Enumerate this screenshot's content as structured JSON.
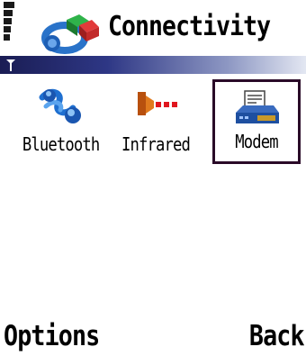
{
  "title_pane": {
    "title": "Connectivity",
    "app_icon": "connectivity-icon",
    "signal_icon": "signal-strength-icon",
    "antenna_icon": "antenna-icon"
  },
  "grid": {
    "items": [
      {
        "label": "Bluetooth",
        "icon": "bluetooth-icon",
        "selected": false
      },
      {
        "label": "Infrared",
        "icon": "infrared-icon",
        "selected": false
      },
      {
        "label": "Modem",
        "icon": "modem-icon",
        "selected": true
      }
    ]
  },
  "softkeys": {
    "left": "Options",
    "right": "Back"
  },
  "colors": {
    "band_dark": "#1a1d54",
    "band_light": "#e3e7f2",
    "selection_border": "#2a0a28"
  }
}
